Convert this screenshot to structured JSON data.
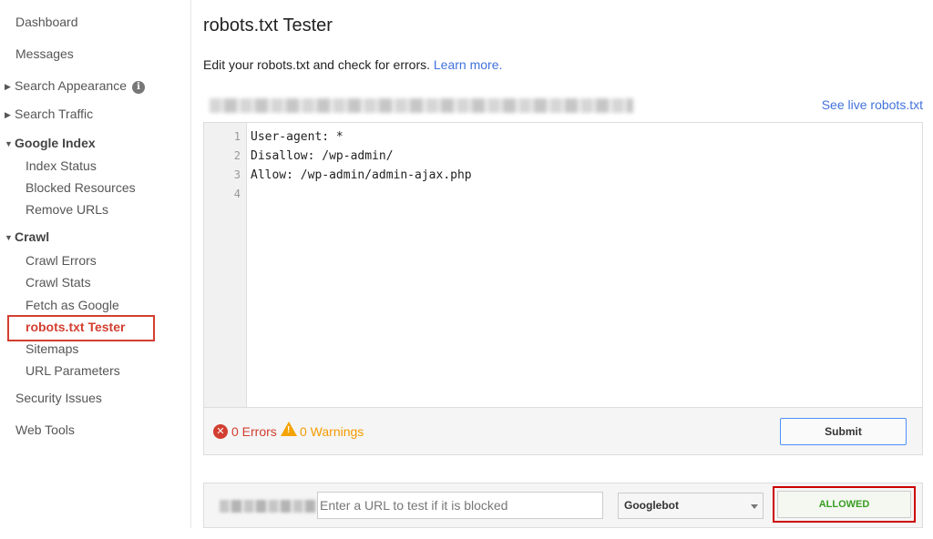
{
  "sidebar": {
    "dashboard": "Dashboard",
    "messages": "Messages",
    "search_appearance": "Search Appearance",
    "search_traffic": "Search Traffic",
    "google_index": "Google Index",
    "google_index_items": [
      "Index Status",
      "Blocked Resources",
      "Remove URLs"
    ],
    "crawl": "Crawl",
    "crawl_items": [
      "Crawl Errors",
      "Crawl Stats",
      "Fetch as Google",
      "robots.txt Tester",
      "Sitemaps",
      "URL Parameters"
    ],
    "security_issues": "Security Issues",
    "web_tools": "Web Tools",
    "info_icon": "i"
  },
  "main": {
    "title": "robots.txt Tester",
    "intro_text": "Edit your robots.txt and check for errors.",
    "learn_more": "Learn more.",
    "see_live": "See live robots.txt"
  },
  "editor": {
    "line_numbers": [
      "1",
      "2",
      "3",
      "4"
    ],
    "lines": [
      "User-agent: *",
      "Disallow: /wp-admin/",
      "Allow: /wp-admin/admin-ajax.php",
      ""
    ]
  },
  "status": {
    "errors": "0 Errors",
    "warnings": "0 Warnings",
    "submit_label": "Submit",
    "error_glyph": "✕",
    "warning_glyph": "!"
  },
  "tester": {
    "url_placeholder": "Enter a URL to test if it is blocked",
    "bot_selected": "Googlebot",
    "result": "ALLOWED"
  },
  "colors": {
    "link": "#4272db",
    "active": "#d23f31",
    "error": "#d23f31",
    "warning": "#f49b00",
    "allowed": "#3a9d23"
  }
}
